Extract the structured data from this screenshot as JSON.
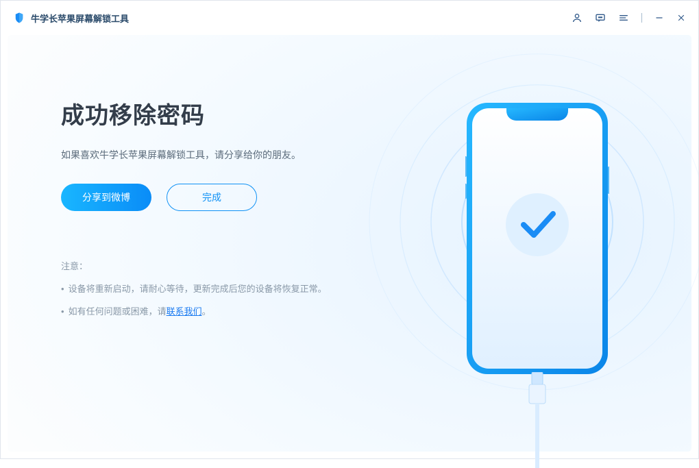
{
  "app": {
    "title": "牛学长苹果屏幕解锁工具"
  },
  "main": {
    "headline": "成功移除密码",
    "subtext": "如果喜欢牛学长苹果屏幕解锁工具，请分享给你的朋友。",
    "buttons": {
      "share": "分享到微博",
      "done": "完成"
    },
    "notice": {
      "title": "注意：",
      "items": {
        "item1": "设备将重新启动，请耐心等待，更新完成后您的设备将恢复正常。",
        "item2_prefix": "如有任何问题或困难，请",
        "item2_link": "联系我们",
        "item2_suffix": "。"
      }
    }
  }
}
